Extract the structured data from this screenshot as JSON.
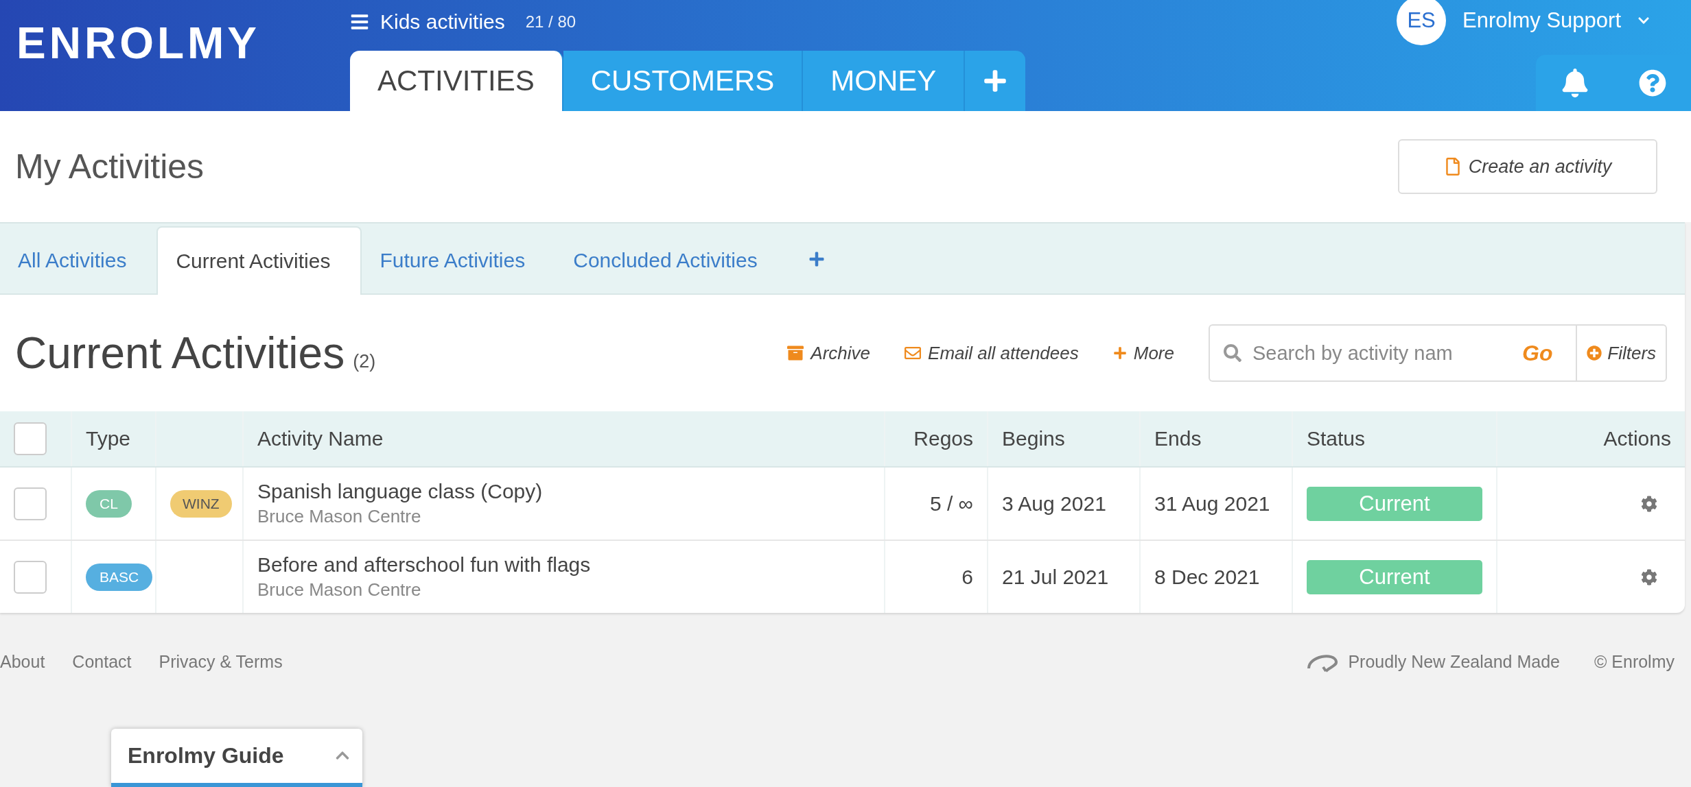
{
  "header": {
    "logo": "ENROLMY",
    "org": {
      "name": "Kids activities",
      "count": "21 / 80"
    },
    "nav_tabs": [
      {
        "label": "ACTIVITIES",
        "selected": true
      },
      {
        "label": "CUSTOMERS",
        "selected": false
      },
      {
        "label": "MONEY",
        "selected": false
      }
    ],
    "user": {
      "initials": "ES",
      "name": "Enrolmy Support"
    }
  },
  "page": {
    "title": "My Activities",
    "create_button": "Create an activity"
  },
  "sub_tabs": [
    {
      "label": "All Activities",
      "selected": false
    },
    {
      "label": "Current Activities",
      "selected": true
    },
    {
      "label": "Future Activities",
      "selected": false
    },
    {
      "label": "Concluded Activities",
      "selected": false
    }
  ],
  "list": {
    "title": "Current Activities",
    "count": "(2)",
    "actions": [
      {
        "kind": "archive",
        "label": "Archive"
      },
      {
        "kind": "email",
        "label": "Email all attendees"
      },
      {
        "kind": "more",
        "label": "More"
      }
    ],
    "search": {
      "placeholder": "Search by activity nam",
      "go": "Go"
    },
    "filters": "Filters"
  },
  "table": {
    "select_all_checked": false,
    "columns": [
      "Type",
      "Activity Name",
      "Regos",
      "Begins",
      "Ends",
      "Status",
      "Actions"
    ],
    "rows": [
      {
        "checked": false,
        "type": {
          "label": "CL",
          "color": "#7fc8a9"
        },
        "tag": {
          "label": "WINZ",
          "color": "#f0cb72"
        },
        "name": "Spanish language class (Copy)",
        "venue": "Bruce Mason Centre",
        "regos": "5 / ∞",
        "begins": "3 Aug 2021",
        "ends": "31 Aug 2021",
        "status": "Current"
      },
      {
        "checked": false,
        "type": {
          "label": "BASC",
          "color": "#56afe0"
        },
        "name": "Before and afterschool fun with flags",
        "venue": "Bruce Mason Centre",
        "regos": "6",
        "begins": "21 Jul 2021",
        "ends": "8 Dec 2021",
        "status": "Current"
      }
    ]
  },
  "footer": {
    "links": [
      "About",
      "Contact",
      "Privacy & Terms"
    ],
    "made": "Proudly New Zealand Made",
    "copyright": "© Enrolmy"
  },
  "guide": {
    "title": "Enrolmy Guide"
  }
}
